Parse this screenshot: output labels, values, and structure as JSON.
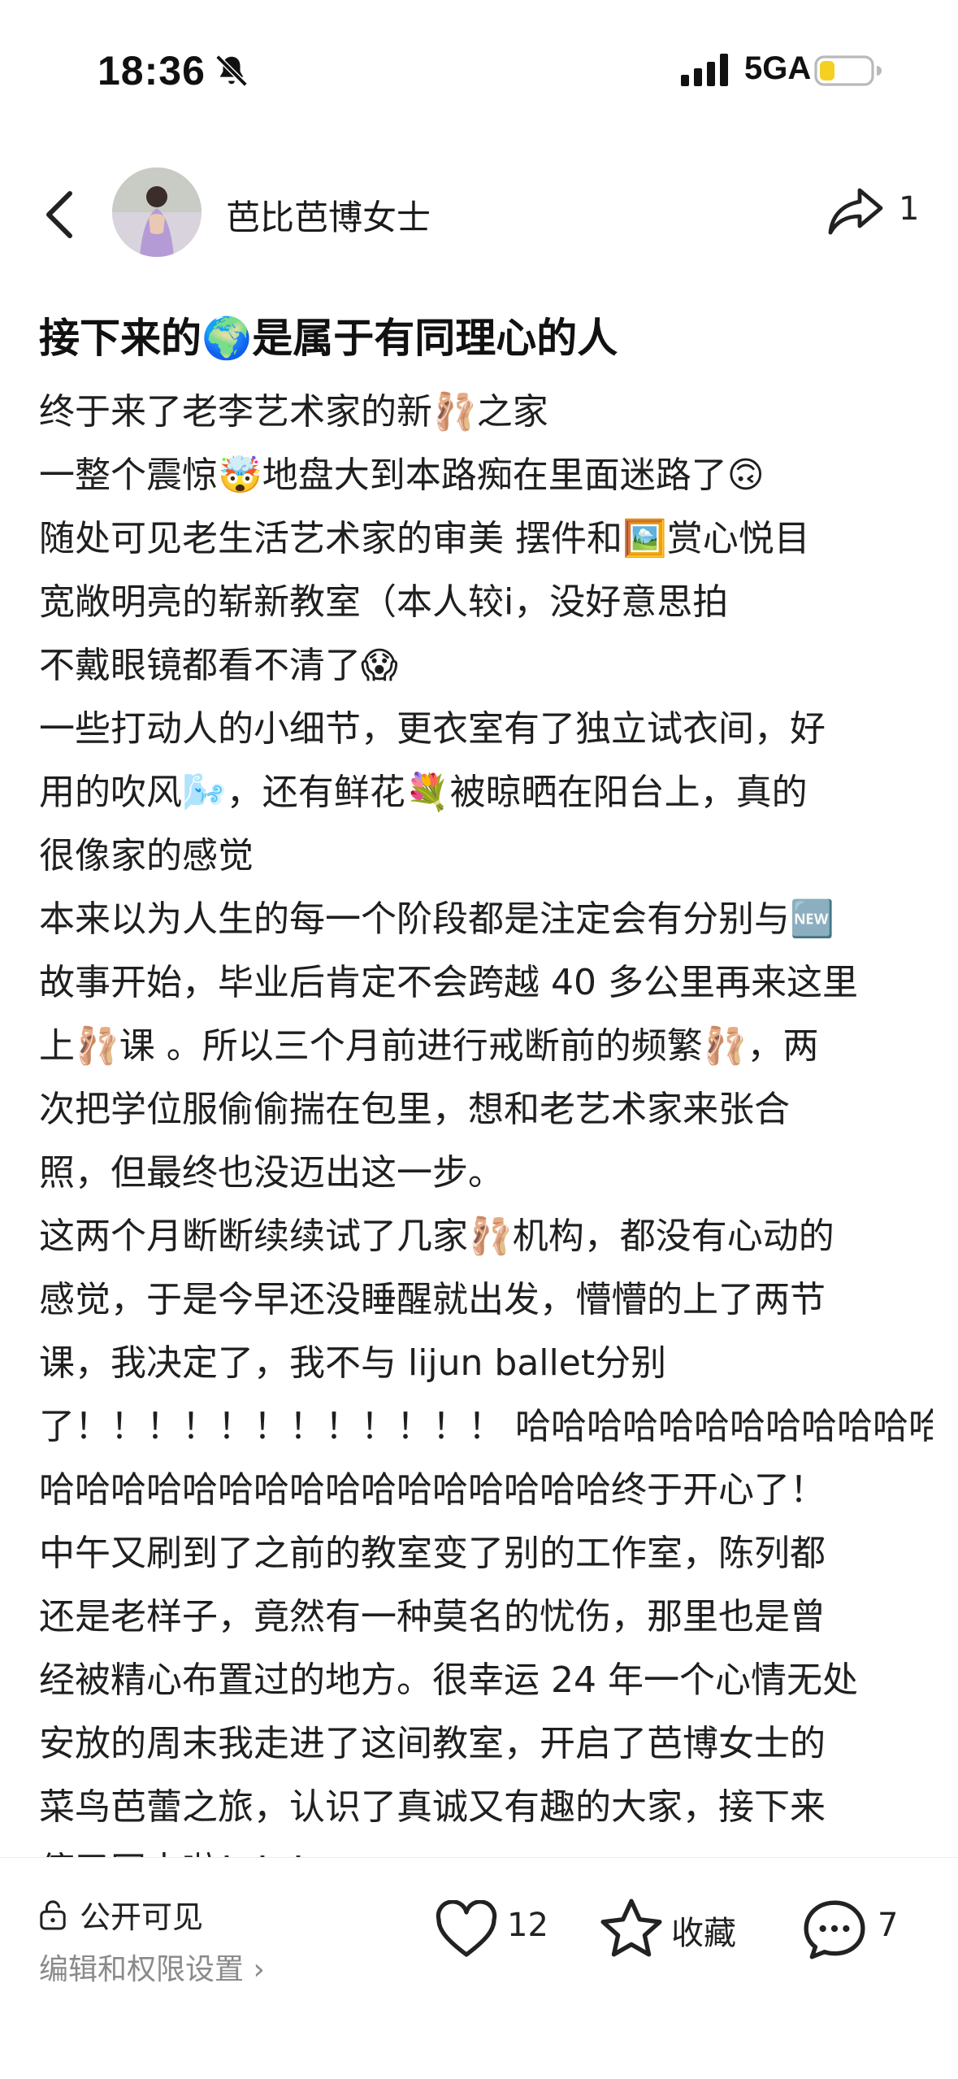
{
  "status_bar": {
    "time": "18:36",
    "network": "5GA",
    "icons": [
      "bell-muted-icon",
      "signal-icon",
      "battery-icon"
    ]
  },
  "header": {
    "username": "芭比芭博女士",
    "share_count": "1",
    "icons": [
      "back-icon",
      "share-icon"
    ]
  },
  "post": {
    "title": "接下来的🌍是属于有同理心的人",
    "lines": [
      "终于来了老李艺术家的新🩰之家",
      "一整个震惊🤯地盘大到本路痴在里面迷路了🙃",
      "随处可见老生活艺术家的审美 摆件和🖼️赏心悦目",
      "宽敞明亮的崭新教室（本人较i，没好意思拍",
      "不戴眼镜都看不清了😱",
      "一些打动人的小细节，更衣室有了独立试衣间，好",
      "用的吹风🌬️，还有鲜花💐被晾晒在阳台上，真的",
      "很像家的感觉",
      "本来以为人生的每一个阶段都是注定会有分别与🆕",
      "故事开始，毕业后肯定不会跨越 40 多公里再来这里",
      "上🩰课 。所以三个月前进行戒断前的频繁🩰，两",
      "次把学位服偷偷揣在包里，想和老艺术家来张合",
      "照，但最终也没迈出这一步。",
      "这两个月断断续续试了几家🩰机构，都没有心动的",
      "感觉，于是今早还没睡醒就出发，懵懵的上了两节",
      "课，我决定了，我不与 lijun ballet分别",
      "了！！！！！！！！！！！！ 哈哈哈哈哈哈哈哈哈哈哈哈哈",
      "哈哈哈哈哈哈哈哈哈哈哈哈哈哈哈哈终于开心了！",
      "中午又刷到了之前的教室变了别的工作室，陈列都",
      "还是老样子，竟然有一种莫名的忧伤，那里也是曾",
      "经被精心布置过的地方。很幸运 24 年一个心情无处",
      "安放的周末我走进了这间教室，开启了芭博女士的",
      "菜鸟芭蕾之旅，认识了真诚又有趣的大家，接下来",
      "停又同志啦！！！"
    ]
  },
  "bottom_bar": {
    "visibility": "公开可见",
    "settings_link": "编辑和权限设置 ›",
    "like_count": "12",
    "collect_label": "收藏",
    "comment_count": "7",
    "icons": [
      "lock-icon",
      "heart-icon",
      "star-icon",
      "comment-icon"
    ]
  }
}
